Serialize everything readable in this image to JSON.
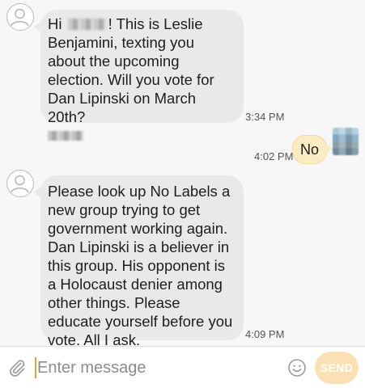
{
  "conversation": {
    "messages": [
      {
        "direction": "incoming",
        "text_before_name": "Hi ",
        "text_after_name": "! This is Leslie Benjamini, texting you about the upcoming election. Will you vote for Dan Lipinski on March 20th?",
        "time": "3:34 PM"
      },
      {
        "direction": "outgoing",
        "text": "No",
        "time": "4:02 PM"
      },
      {
        "direction": "incoming",
        "text": "Please look up No Labels a new group trying to get government working again. Dan Lipinski is a believer in this group. His opponent is a Holocaust denier among other things. Please educate yourself before you vote. All I ask.",
        "time": "4:09 PM"
      }
    ]
  },
  "composer": {
    "placeholder": "Enter message",
    "send_label": "SEND",
    "attach_icon": "paperclip-icon",
    "emoji_icon": "smiley-icon"
  },
  "colors": {
    "incoming_bubble": "#e9e9e9",
    "outgoing_bubble": "#fbecc4",
    "accent": "#e8a13a",
    "send_button": "#fbe0b3"
  }
}
